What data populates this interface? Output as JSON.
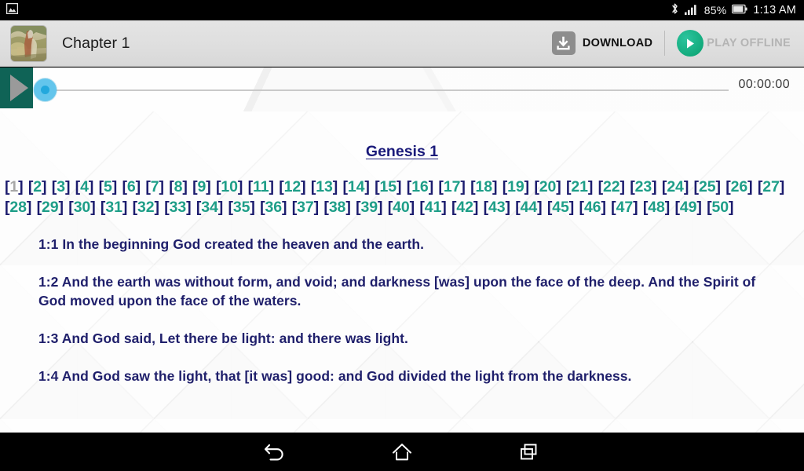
{
  "status_bar": {
    "notification_icon": "gallery-icon",
    "bluetooth_icon": "bluetooth-icon",
    "signal_icon": "signal-bars-icon",
    "battery_percent": "85%",
    "battery_icon": "battery-icon",
    "clock": "1:13 AM"
  },
  "app_bar": {
    "thumbnail_name": "chapter-thumbnail",
    "title": "Chapter 1",
    "download": {
      "label": "DOWNLOAD",
      "icon": "download-icon",
      "enabled": true
    },
    "play_offline": {
      "label": "PLAY OFFLINE",
      "icon": "play-circle-icon",
      "enabled": false
    }
  },
  "player": {
    "play_icon": "play-triangle-icon",
    "elapsed_time": "00:00:00",
    "progress_percent": 0
  },
  "document": {
    "heading": "Genesis 1",
    "verse_links": [
      "1",
      "2",
      "3",
      "4",
      "5",
      "6",
      "7",
      "8",
      "9",
      "10",
      "11",
      "12",
      "13",
      "14",
      "15",
      "16",
      "17",
      "18",
      "19",
      "20",
      "21",
      "22",
      "23",
      "24",
      "25",
      "26",
      "27",
      "28",
      "29",
      "30",
      "31",
      "32",
      "33",
      "34",
      "35",
      "36",
      "37",
      "38",
      "39",
      "40",
      "41",
      "42",
      "43",
      "44",
      "45",
      "46",
      "47",
      "48",
      "49",
      "50"
    ],
    "current_verse": "1",
    "verses": [
      {
        "ref": "1:1",
        "text": "In the beginning God created the heaven and the earth."
      },
      {
        "ref": "1:2",
        "text": "And the earth was without form, and void; and darkness [was] upon the face of the deep. And the Spirit of God moved upon the face of the waters."
      },
      {
        "ref": "1:3",
        "text": "And God said, Let there be light: and there was light."
      },
      {
        "ref": "1:4",
        "text": "And God saw the light, that [it was] good: and God divided the light from the darkness."
      }
    ]
  },
  "nav_bar": {
    "back": "back-icon",
    "home": "home-icon",
    "recents": "recent-apps-icon"
  },
  "colors": {
    "status_bar_bg": "#000000",
    "app_bar_bg": "#e0e0e0",
    "accent_teal": "#0f6356",
    "play_green": "#10a878",
    "seek_thumb": "#63c5ec",
    "heading_navy": "#1a1a7a",
    "verse_navy": "#1f1f6b",
    "verse_link_teal": "#1e9e88",
    "current_verse_gray": "#a8a8a8"
  }
}
